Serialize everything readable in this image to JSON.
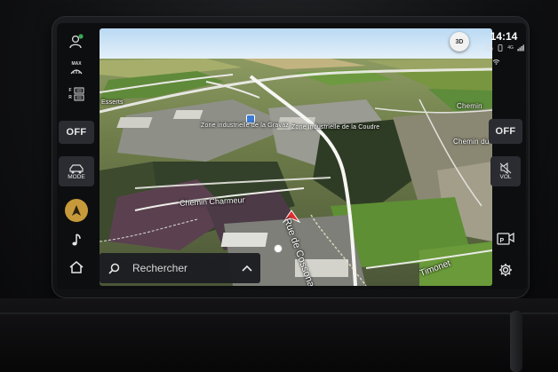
{
  "status_bar": {
    "time": "14:14",
    "network": "4G"
  },
  "climate": {
    "max_defrost_label": "MAX",
    "front_defrost_label": "F",
    "rear_defrost_label": "R",
    "left_off_label": "OFF",
    "right_off_label": "OFF"
  },
  "left_panel": {
    "mode_label": "MODE"
  },
  "right_panel": {
    "vol_label": "VOL"
  },
  "map": {
    "view_mode": "3D",
    "places": {
      "zone_gravaz": "Zone industrielle de la Gravaz",
      "zone_coudre": "Zone industrielle de la Coudre",
      "esserts": "Esserts",
      "chemin_charmeur": "Chemin Charmeur",
      "rue_cossonay": "Rue de Cossonay",
      "chemin_right": "Chemin",
      "chemin_du": "Chemin du",
      "timonet": "Timonet"
    }
  },
  "search": {
    "placeholder": "Rechercher"
  },
  "icons": {
    "profile": "profile-icon",
    "navigation": "navigation-arrow-icon",
    "music": "music-note-icon",
    "home": "home-icon",
    "settings": "gear-icon",
    "mute": "speaker-mute-icon",
    "parking_camera": "parking-camera-icon",
    "search": "search-icon",
    "chevron": "chevron-up-icon"
  },
  "colors": {
    "nav_accent": "#c69a3a",
    "vehicle_marker": "#e03030",
    "panel_bg": "#2a2c31"
  }
}
